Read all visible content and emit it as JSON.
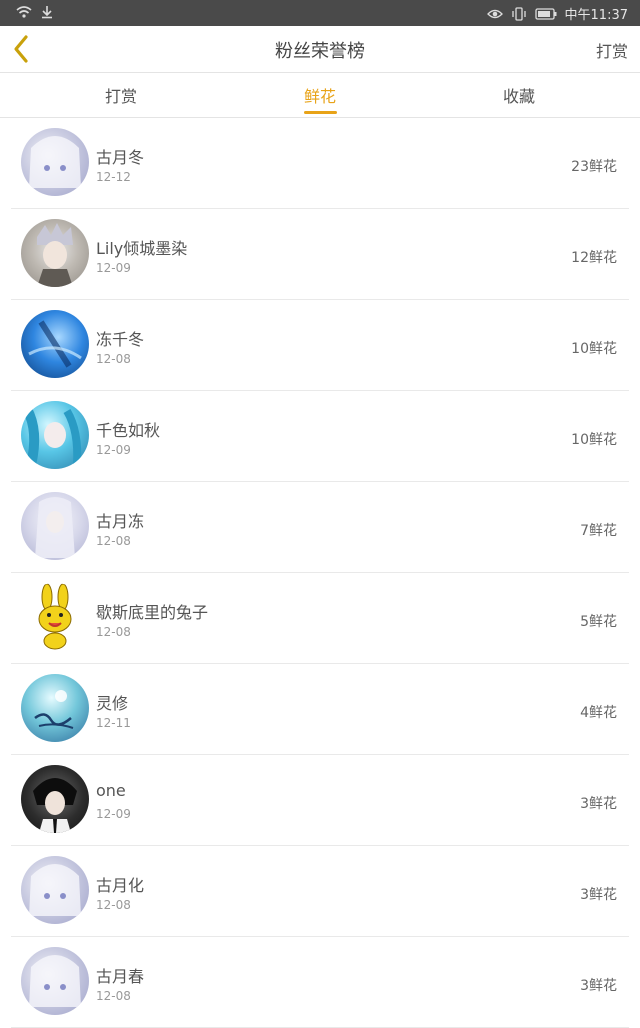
{
  "status_bar": {
    "time": "中午11:37",
    "icons": [
      "wifi-icon",
      "download-icon",
      "eye-icon",
      "vibrate-icon",
      "battery-icon"
    ]
  },
  "header": {
    "title": "粉丝荣誉榜",
    "action_label": "打赏",
    "back_icon": "chevron-left-icon",
    "accent_color": "#e8a318"
  },
  "tabs": [
    {
      "label": "打赏"
    },
    {
      "label": "鲜花"
    },
    {
      "label": "收藏"
    }
  ],
  "active_tab": "鲜花",
  "fans": [
    {
      "name": "古月冬",
      "date": "12-12",
      "count": "23鲜花",
      "avatar": "anime-avatar-white-hair"
    },
    {
      "name": "Lily倾城墨染",
      "date": "12-09",
      "count": "12鲜花",
      "avatar": "anime-avatar-silver-hair"
    },
    {
      "name": "冻千冬",
      "date": "12-08",
      "count": "10鲜花",
      "avatar": "anime-avatar-blue"
    },
    {
      "name": "千色如秋",
      "date": "12-09",
      "count": "10鲜花",
      "avatar": "anime-avatar-cyan-hair"
    },
    {
      "name": "古月冻",
      "date": "12-08",
      "count": "7鲜花",
      "avatar": "anime-avatar-pale"
    },
    {
      "name": "歇斯底里的兔子",
      "date": "12-08",
      "count": "5鲜花",
      "avatar": "yellow-rabbit-avatar"
    },
    {
      "name": "灵修",
      "date": "12-11",
      "count": "4鲜花",
      "avatar": "calligraphy-avatar"
    },
    {
      "name": "one",
      "date": "12-09",
      "count": "3鲜花",
      "avatar": "dark-hair-avatar"
    },
    {
      "name": "古月化",
      "date": "12-08",
      "count": "3鲜花",
      "avatar": "anime-avatar-white-hair"
    },
    {
      "name": "古月春",
      "date": "12-08",
      "count": "3鲜花",
      "avatar": "anime-avatar-white-hair"
    }
  ]
}
